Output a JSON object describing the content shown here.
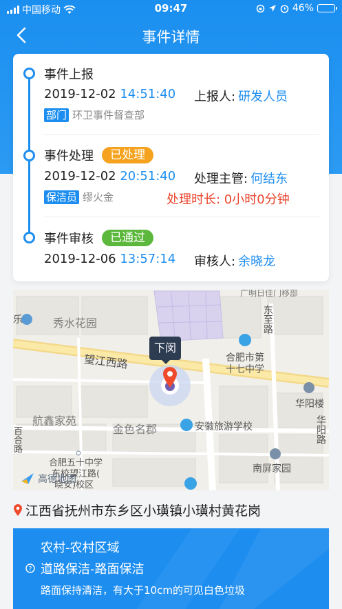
{
  "status_bar": {
    "carrier": "中国移动",
    "time": "09:47",
    "battery": "46%",
    "battery_level": 0.46
  },
  "nav": {
    "title": "事件详情"
  },
  "timeline": [
    {
      "title": "事件上报",
      "date": "2019-12-02",
      "time": "14:51:40",
      "right_label": "上报人:",
      "right_value": "研发人员",
      "tag": "部门",
      "tag_text": "环卫事件督查部"
    },
    {
      "title": "事件处理",
      "badge": "已处理",
      "badge_color": "#f5a31f",
      "date": "2019-12-02",
      "time": "20:51:40",
      "right_label": "处理主管:",
      "right_value": "何结东",
      "tag": "保洁员",
      "tag_text": "缪火金",
      "duration": "处理时长: 0小时0分钟"
    },
    {
      "title": "事件审核",
      "badge": "已通过",
      "badge_color": "#5cb83c",
      "date": "2019-12-06",
      "time": "13:57:14",
      "right_label": "审核人:",
      "right_value": "余晓龙"
    }
  ],
  "map": {
    "labels": {
      "xiushui": "秀水花园",
      "wangjiang": "望江西路",
      "hangxin": "航鑫家苑",
      "jinse": "金色名郡",
      "anhui": "安徽旅游学校",
      "hefei17": "合肥市第",
      "hefei17b": "十七中学",
      "huayang": "华阳楼",
      "huayangroad": "华阳路",
      "dongzhi": "东至路",
      "nanping": "南屏家园",
      "hefei50a": "合肥五十中学",
      "hefei50b": "东校望江路(",
      "hefei50c": "晓安)校区",
      "top": "广明日佳门移部",
      "yu": "乐",
      "side": "百合路",
      "gaode": "高德地图"
    },
    "popup": "下闵"
  },
  "address": "江西省抚州市东乡区小璜镇小璜村黄花岗",
  "info": {
    "area": "农村-农村区域",
    "category": "道路保洁-路面保洁",
    "description": "路面保持清洁，有大于10cm的可见白色垃圾"
  },
  "colors": {
    "primary": "#1d8ef0",
    "warn": "#e9452d"
  }
}
